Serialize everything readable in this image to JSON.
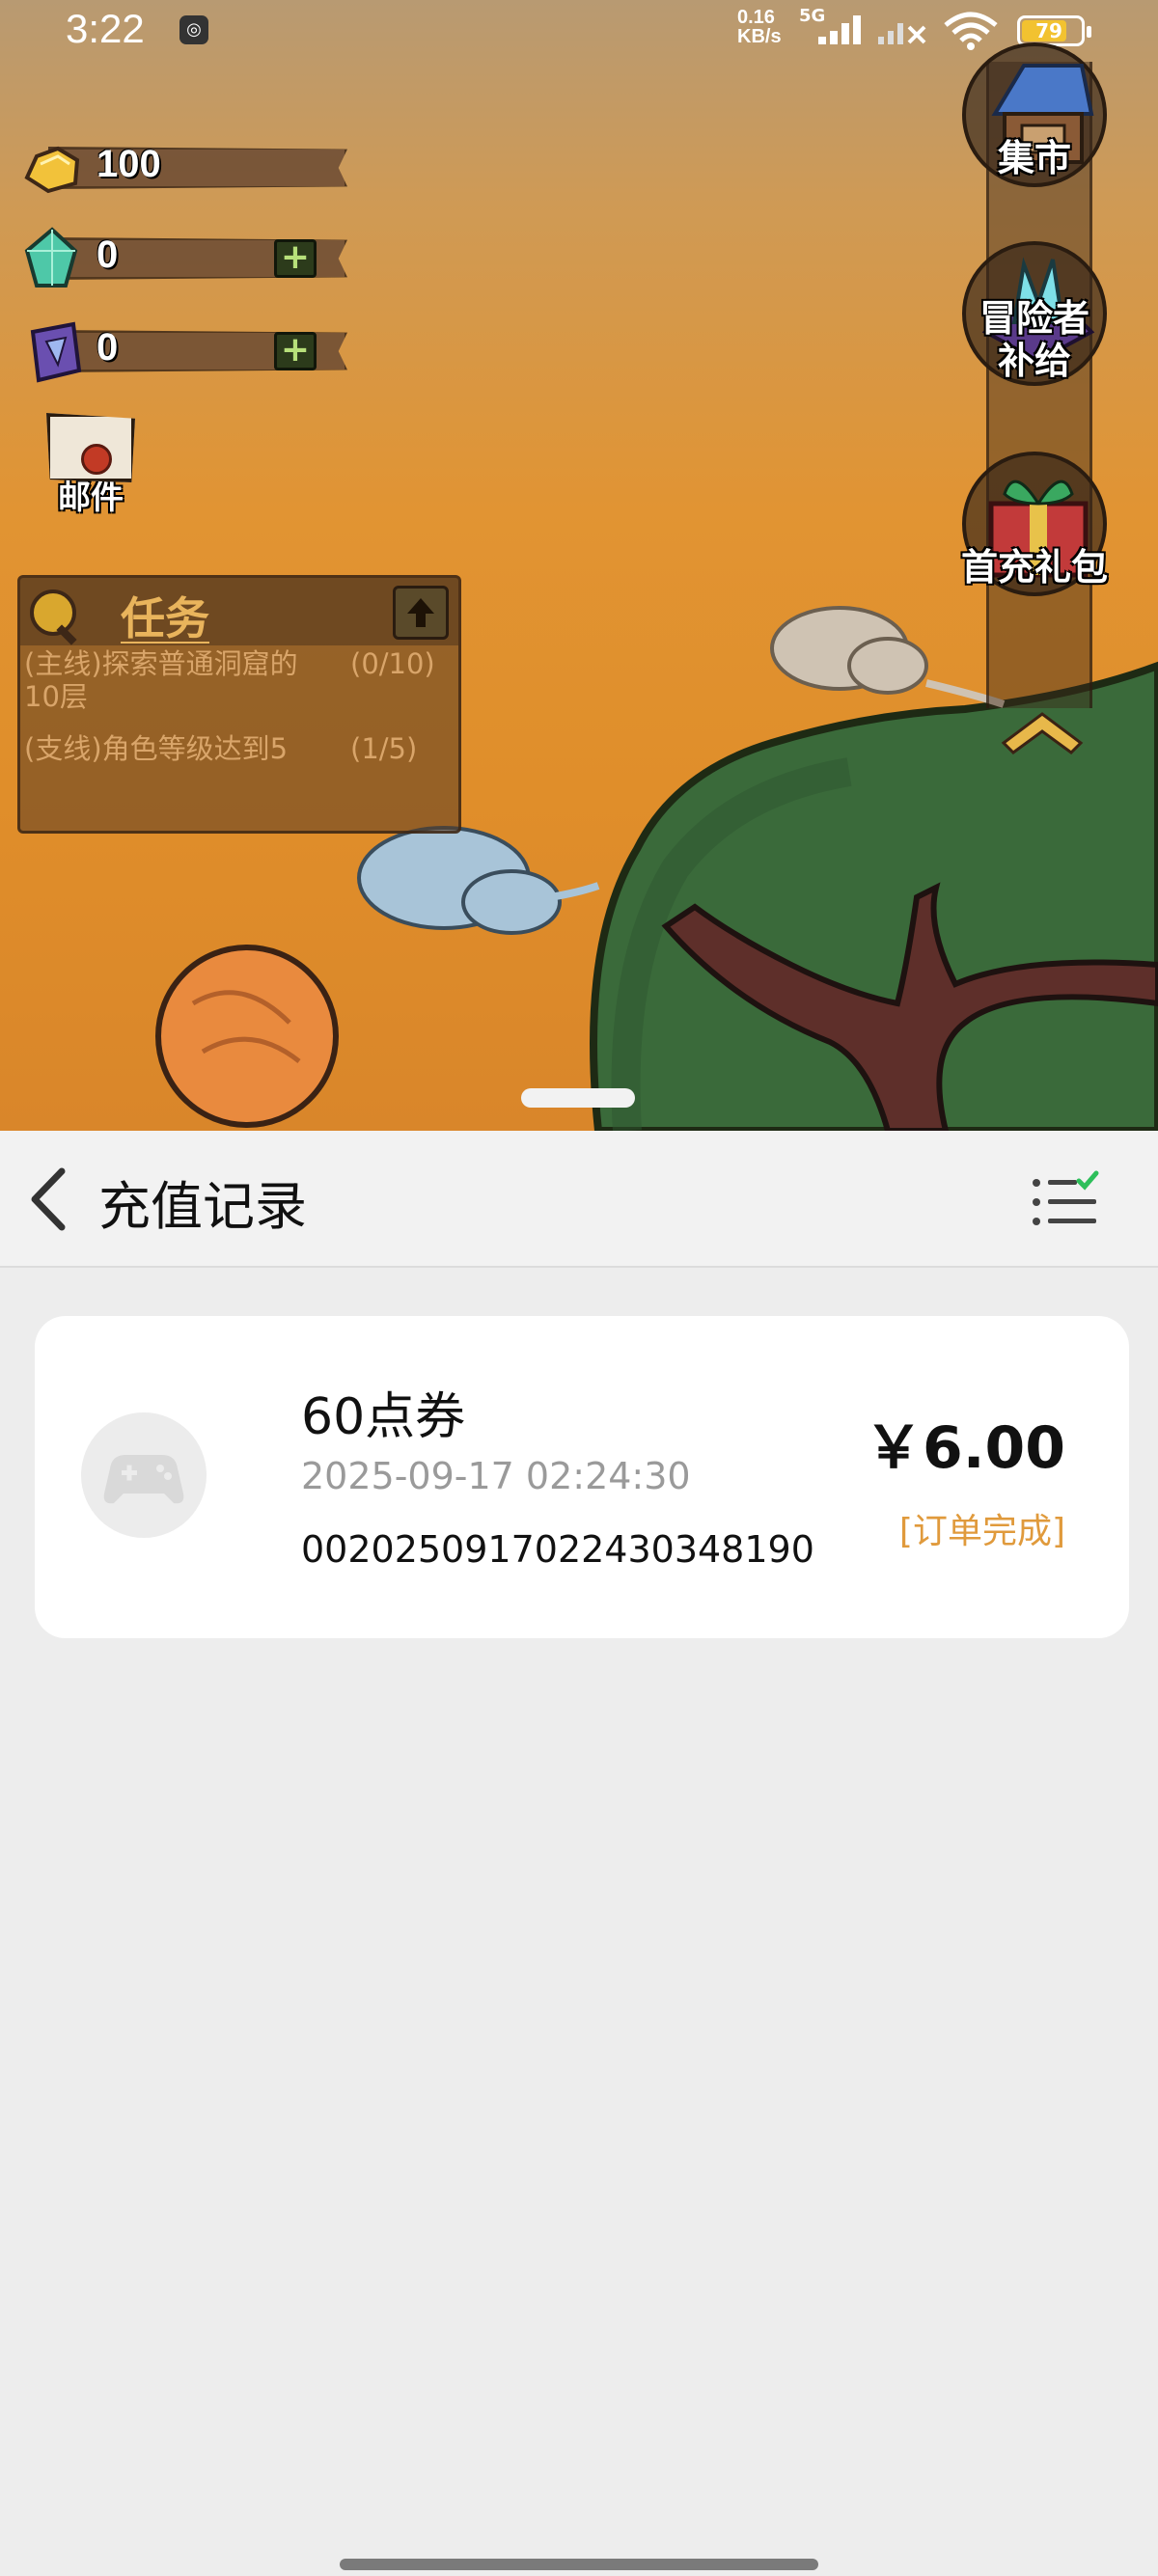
{
  "status_bar": {
    "time": "3:22",
    "notification_icon": "app-notification-icon",
    "net_speed": "0.16",
    "net_unit": "KB/s",
    "network": "5G",
    "battery": "79"
  },
  "game": {
    "resources": [
      {
        "icon": "gold-icon",
        "value": "100",
        "has_plus": false
      },
      {
        "icon": "diamond-icon",
        "value": "0",
        "has_plus": true
      },
      {
        "icon": "crystal-card-icon",
        "value": "0",
        "has_plus": true
      }
    ],
    "mail_label": "邮件",
    "quest": {
      "title": "任务",
      "items": [
        {
          "text": "(主线)探索普通洞窟的10层",
          "progress": "(0/10)"
        },
        {
          "text": "(支线)角色等级达到5",
          "progress": "(1/5)"
        }
      ]
    },
    "side_buttons": [
      {
        "label": "集市",
        "icon": "market-stall-icon"
      },
      {
        "label": "冒险者补给",
        "line1": "冒险者",
        "line2": "补给",
        "icon": "crystal-supply-icon"
      },
      {
        "label": "首充礼包",
        "icon": "gift-box-icon"
      }
    ]
  },
  "recharge": {
    "title": "充值记录",
    "back_icon": "chevron-left-icon",
    "list_icon": "checked-list-icon",
    "records": [
      {
        "name": "60点券",
        "datetime": "2025-09-17 02:24:30",
        "order_no": "0020250917022430348190",
        "amount": "￥6.00",
        "status": "[订单完成]",
        "icon": "gamepad-icon"
      }
    ]
  },
  "colors": {
    "status_orange": "#e09a3c",
    "panel_bg": "#ededed",
    "card_bg": "#ffffff"
  }
}
